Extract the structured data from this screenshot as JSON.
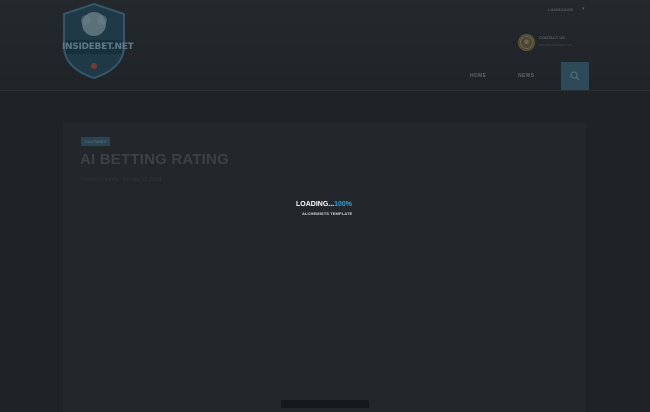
{
  "header": {
    "logo_text": "INSIDEBET.NET",
    "language": "LANGUAGE",
    "contact": {
      "label": "CONTACT US",
      "sub": "info@insidebet.net"
    },
    "nav": [
      {
        "label": "HOME"
      },
      {
        "label": "NEWS"
      }
    ],
    "active_nav_icon": "search-icon"
  },
  "article": {
    "tag": "CULTURES",
    "title": "AI BETTING RATING",
    "meta": "Posted by admin · January 15, 2024",
    "paragraphs": [
      "",
      "",
      "",
      "",
      "",
      "",
      "",
      ""
    ]
  },
  "loader": {
    "text": "LOADING...",
    "percent": "100%",
    "subtitle": "ALCHEMISTS TEMPLATE"
  },
  "colors": {
    "accent": "#2aa3d6",
    "background": "#1e2327",
    "header_bg": "#24292d"
  }
}
